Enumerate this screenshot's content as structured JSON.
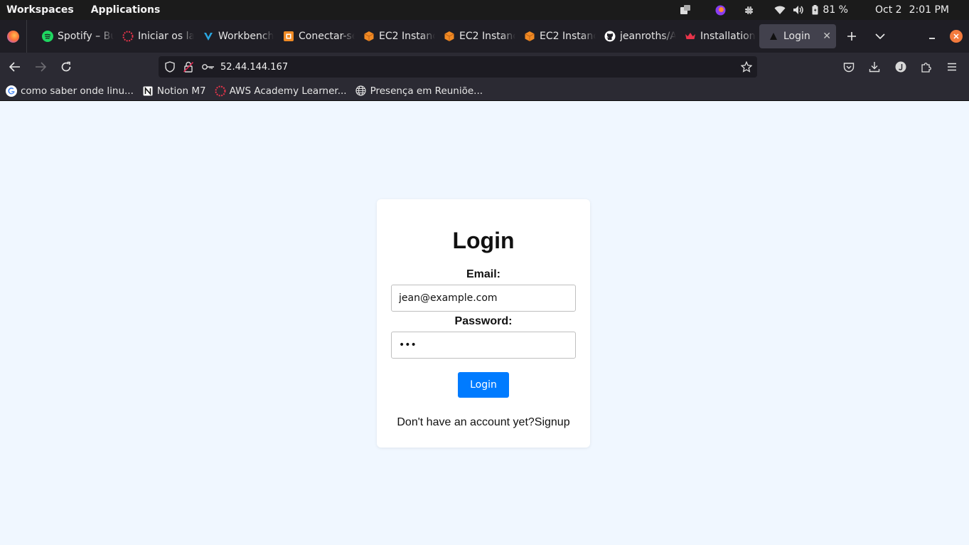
{
  "system_bar": {
    "menus": [
      "Workspaces",
      "Applications"
    ],
    "battery": "81 %",
    "date": "Oct 2",
    "time": "2:01 PM"
  },
  "tabs": [
    {
      "title": "Spotify – Bu",
      "icon": "spotify-icon",
      "color": "#1ed760"
    },
    {
      "title": "Iniciar os la",
      "icon": "aws-academy-icon",
      "color": "#e8344a"
    },
    {
      "title": "Workbench",
      "icon": "vocareum-icon",
      "color": "#2aa6e0"
    },
    {
      "title": "Conectar-se",
      "icon": "ec2-connect-icon",
      "color": "#f08a24"
    },
    {
      "title": "EC2 Instanc",
      "icon": "aws-cube-icon",
      "color": "#f08a24"
    },
    {
      "title": "EC2 Instanc",
      "icon": "aws-cube-icon",
      "color": "#f08a24"
    },
    {
      "title": "EC2 Instanc",
      "icon": "aws-cube-icon",
      "color": "#f08a24"
    },
    {
      "title": "jeanroths/A",
      "icon": "github-icon",
      "color": "#ffffff"
    },
    {
      "title": "Installation",
      "icon": "crown-icon",
      "color": "#e8344a"
    }
  ],
  "active_tab": {
    "title": "Login",
    "icon": "triangle-icon"
  },
  "navbar": {
    "url": "52.44.144.167"
  },
  "bookmarks": [
    {
      "label": "como saber onde linu...",
      "icon": "google-icon"
    },
    {
      "label": "Notion M7",
      "icon": "notion-icon"
    },
    {
      "label": "AWS Academy Learner...",
      "icon": "aws-academy-icon"
    },
    {
      "label": "Presença em Reuniõe...",
      "icon": "globe-icon"
    }
  ],
  "form": {
    "title": "Login",
    "email_label": "Email:",
    "email_value": "jean@example.com",
    "password_label": "Password:",
    "password_value": "abc",
    "submit_label": "Login",
    "signup_prompt": "Don't have an account yet?",
    "signup_link": "Signup"
  },
  "colors": {
    "page_background": "#f0f7ff",
    "button": "#007bff",
    "tab_bar": "#1f1e25",
    "toolbar": "#2b2a33"
  }
}
